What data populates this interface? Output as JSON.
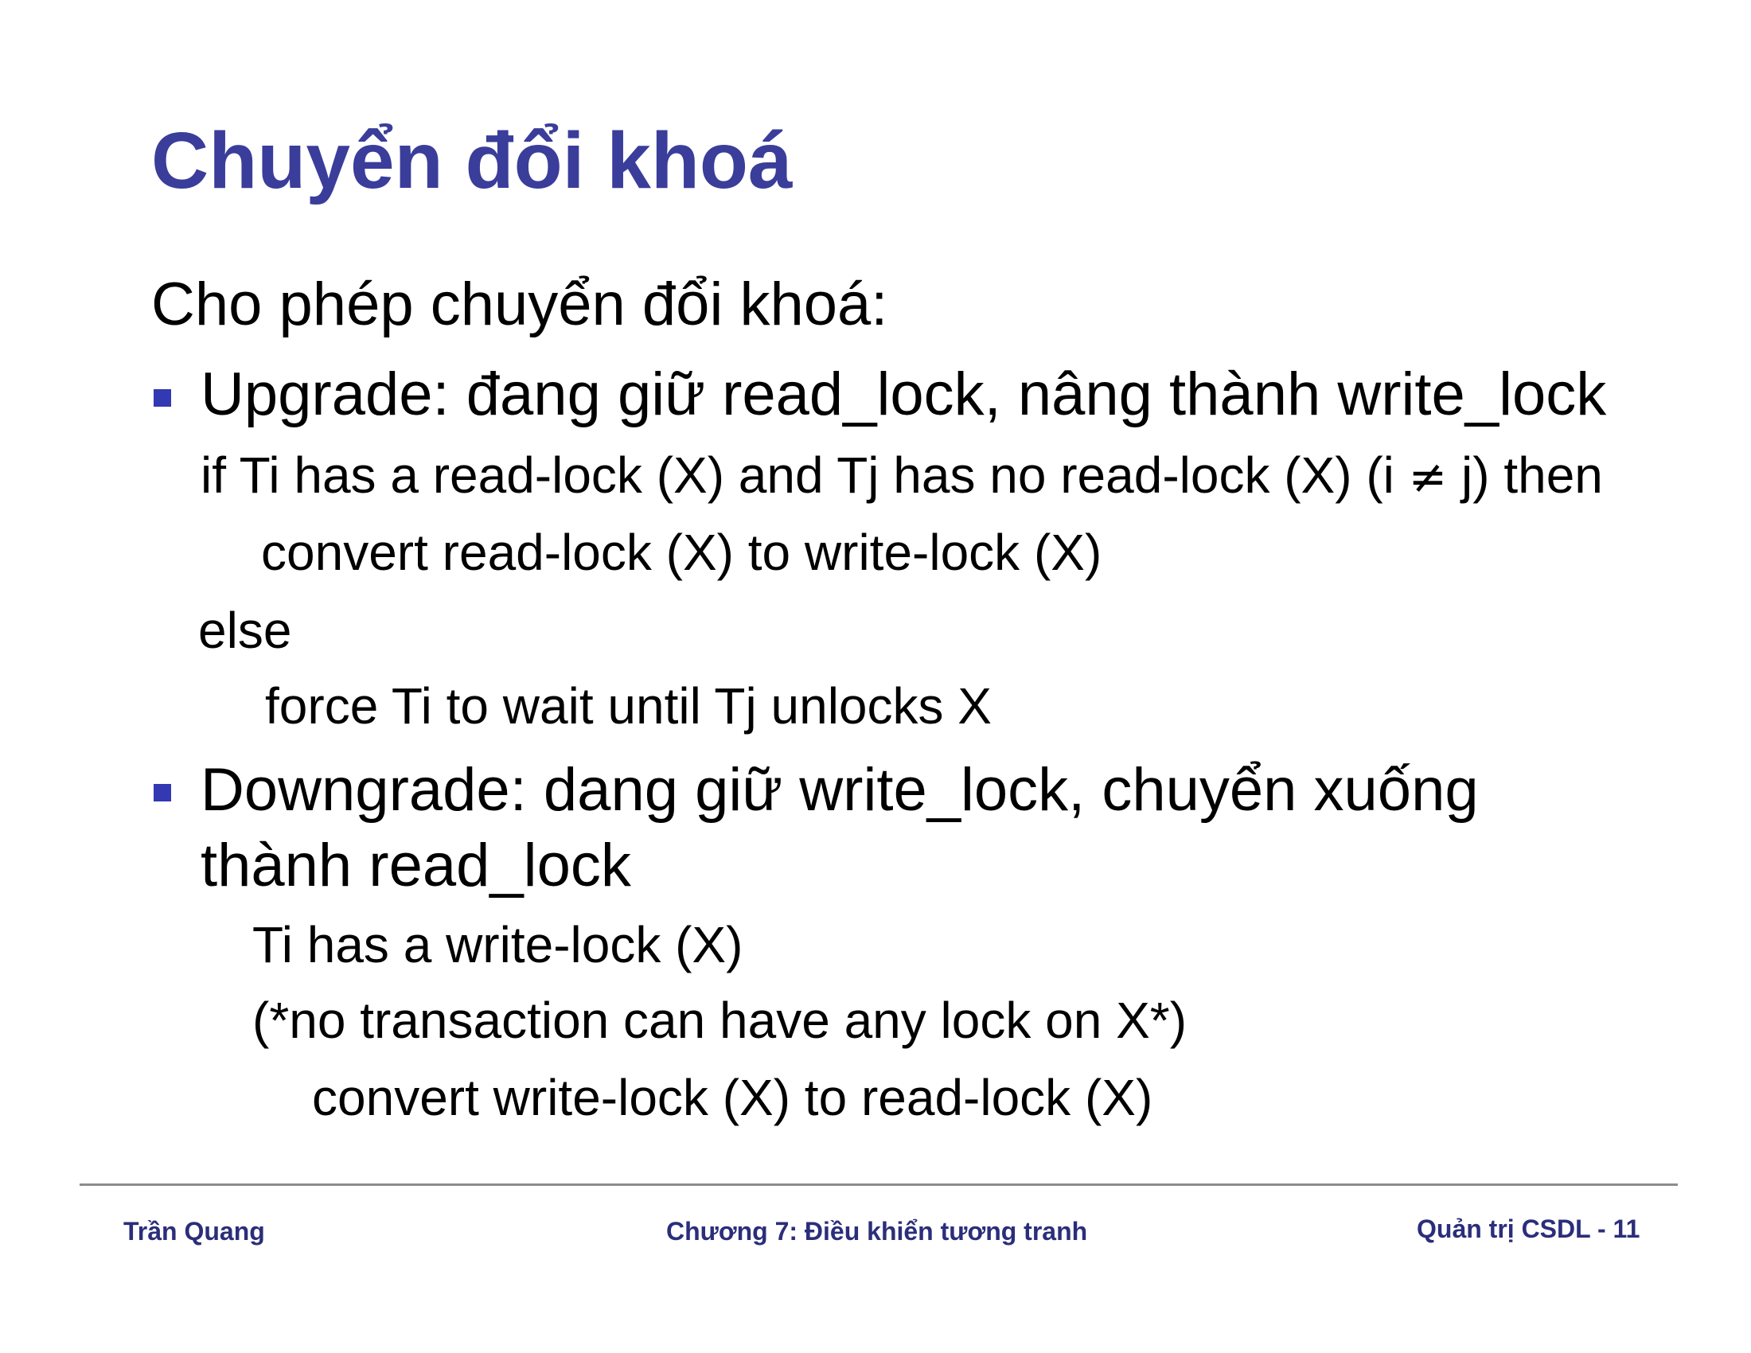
{
  "colors": {
    "title": "#3a3d9a",
    "bullet": "#3338b3",
    "footer": "#2b2e7a",
    "rule": "#8c8c8c",
    "text": "#000000"
  },
  "slide": {
    "title": "Chuyển đổi khoá",
    "intro": "Cho phép chuyển đổi khoá:",
    "upgrade": {
      "bullet_icon": "square-bullet-icon",
      "text": "Upgrade: đang giữ read_lock, nâng thành write_lock",
      "code_if_prefix": "if Ti has a read-lock (X) and Tj has no read-lock (X) (i ",
      "code_neq": "≠",
      "code_if_suffix": " j) then",
      "code_convert": "convert read-lock (X) to write-lock (X)",
      "code_else": "else",
      "code_force": "force Ti to wait until Tj unlocks X"
    },
    "downgrade": {
      "bullet_icon": "square-bullet-icon",
      "text_line1": "Downgrade: dang giữ write_lock, chuyển xuống",
      "text_line2": "thành read_lock",
      "code_has": "Ti has a write-lock (X)",
      "code_comment": "(*no transaction can have any lock on X*)",
      "code_convert": "convert write-lock (X) to read-lock (X)"
    }
  },
  "footer": {
    "author": "Trần Quang",
    "chapter": "Chương 7: Điều khiển tương tranh",
    "page": "Quản trị CSDL - 11"
  }
}
